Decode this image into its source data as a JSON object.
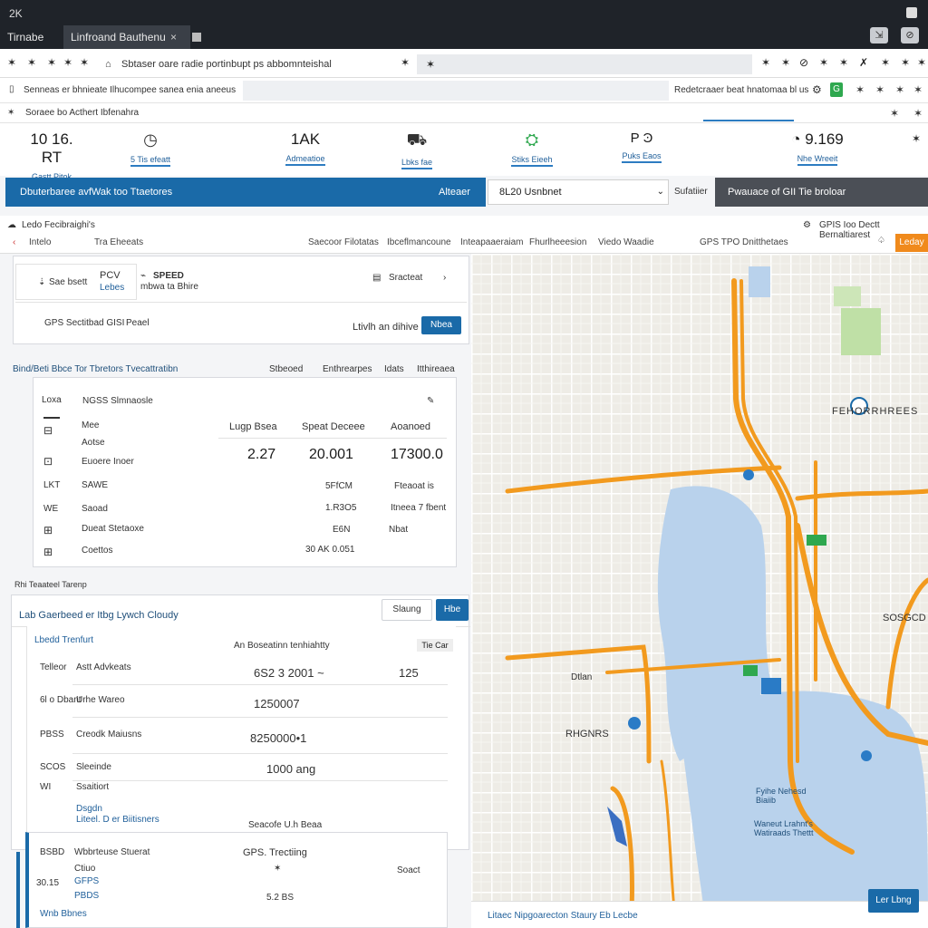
{
  "window": {
    "tabs": [
      {
        "label": "Tirnabe onch"
      },
      {
        "label": "Linfroand Bauthenu"
      }
    ],
    "close_glyph": "×",
    "top_left_glyph": "2K"
  },
  "toolbar": {
    "address": "Sbtaser oare radie portinbupt ps abbomnteishal",
    "right_text": "Redetcraaer beat hnatomaa bl us"
  },
  "toolbar2": {
    "left_text": "Senneas er bhnieate Ilhucompee sanea enia aneeus"
  },
  "toolbar3": {
    "left_text": "Soraee bo Acthert Ibfenahra"
  },
  "stats": [
    {
      "value": "10 16. RT",
      "label": "Gastt Pitok"
    },
    {
      "value": "",
      "label": "5 Tis efeatt"
    },
    {
      "value": "1AK",
      "label": "Admeatioe"
    },
    {
      "value": "",
      "label": "Lbks fae"
    },
    {
      "value": "",
      "label": "Stiks Eieeh"
    },
    {
      "value": "P Ͽ",
      "label": "Puks Eaos"
    },
    {
      "value": "9.169",
      "label": "Nhe Wreeit"
    }
  ],
  "bluebar": {
    "left": "Dbuterbaree avfWak too Ttaetores",
    "right": "Alteaer"
  },
  "select": {
    "value": "8L20  Usnbnet",
    "sub": "Sufatiier"
  },
  "dark_button": "Pwauace of GII Tie broloar",
  "nav2": {
    "top_left": "Ledo Fecibraighi's",
    "items": [
      "Intelo",
      "Tra Eheeats",
      "Saecoor Filotatas",
      "Ibceflmancoune",
      "Inteapaaeraiam",
      "Fhurlheeesion",
      "Viedo Waadie",
      "GPS   TPO Dnitthetaes"
    ],
    "top_right": "GPIS Ioo Dectt Bernaltiarest",
    "orange_button": "Leday"
  },
  "card1": {
    "sub_label": "Sae bsett",
    "pill_top": "PCV",
    "pill_bottom": "Lebes",
    "speed_title": "SPEED",
    "speed_sub": "mbwa ta Bhire",
    "right_label": "Sracteat",
    "gps_label": "GPS  Sectitbad  GISI",
    "pear": "Peael",
    "action_text": "Ltivlh an dihive",
    "action_button": "Nbea"
  },
  "section_header": {
    "title": "Bind/Beti Bbce Tor Tbretors Tvecattratibn",
    "cols": [
      "Stbeoed",
      "Enthrearpes",
      "Idats",
      "Itthireaea"
    ]
  },
  "table1": {
    "label": "Loxa",
    "title": "NGSS Slmnaosle",
    "rows_left": [
      "Mee",
      "Aotse",
      "Euoere Inoer",
      "SAWE",
      "Saoad",
      "Dueat Stetaoxe",
      "Coettos"
    ],
    "side_codes": [
      "LKT",
      "WE"
    ],
    "headers": [
      "Lugp Bsea",
      "Speat Deceee",
      "Aoanoed"
    ],
    "values": [
      "2.27",
      "20.001",
      "17300.0"
    ],
    "sub_values": [
      [
        "5FfCM",
        "Fteaoat is"
      ],
      [
        "1.R3O5",
        "Itneea 7 fbent"
      ],
      [
        "E6N",
        "Nbat"
      ],
      [
        "30 AK 0.051",
        ""
      ]
    ]
  },
  "track_label": "Rhi Teaateel Tarenp",
  "card2": {
    "title": "Lab Gaerbeed er Itbg Lywch Cloudy",
    "button_white": "Slaung",
    "button_blue": "Hbe",
    "sub_title": "Lbedd Trenfurt",
    "center_label": "An Boseatinn tenhiahtty",
    "corner": "Tie Car",
    "rows": [
      {
        "code": "Telleor",
        "label": "Astt Advkeats",
        "value": "6S2 3 2001 ~",
        "extra": "125"
      },
      {
        "code": "6l  o Dbant",
        "label": "Urhe Wareo",
        "value": "1250007",
        "extra": ""
      },
      {
        "code": "PBSS",
        "label": "Creodk Maiusns",
        "value": "8250000•1",
        "extra": ""
      },
      {
        "code": "SCOS",
        "label": "Sleeinde",
        "value": "1000 ang",
        "extra": ""
      },
      {
        "code": "WI",
        "label": "Ssaitiort",
        "value": "",
        "extra": ""
      }
    ],
    "link1": "Dsgdn",
    "link2": "Liteel. D er Biitisners",
    "footer_center": "Seacofe U.h Beaa"
  },
  "bottom": {
    "code": "BSBD",
    "title": "Wbbrteuse Stuerat",
    "gps": "GPS. Trectiing",
    "rows": [
      {
        "code": "",
        "label": "Ctiuo",
        "value": "",
        "right": "Soact"
      },
      {
        "code": "30.15",
        "label": "GFPS",
        "value": "",
        "right": ""
      },
      {
        "code": "",
        "label": "PBDS",
        "value": "5.2 BS",
        "right": ""
      }
    ],
    "footer_link": "Wnb Bbnes"
  },
  "map": {
    "labels": [
      "FEHORRHREES",
      "SOSGCD",
      "RHGNRS",
      "Fyihe Nehesd Biaiib",
      "Waneut Lrahnt's Watiraads Thettt",
      "Dtlan"
    ],
    "footer_text": "Litaec Nipgoarecton Staury Eb Lecbe",
    "button": "Ler Lbng",
    "colors": {
      "road": "#f29a1e",
      "water": "#b9d2ec",
      "park": "#bfe0a6"
    }
  },
  "colors": {
    "accent": "#1a6aa8",
    "orange": "#f08a1c",
    "dark": "#4b4f56"
  }
}
